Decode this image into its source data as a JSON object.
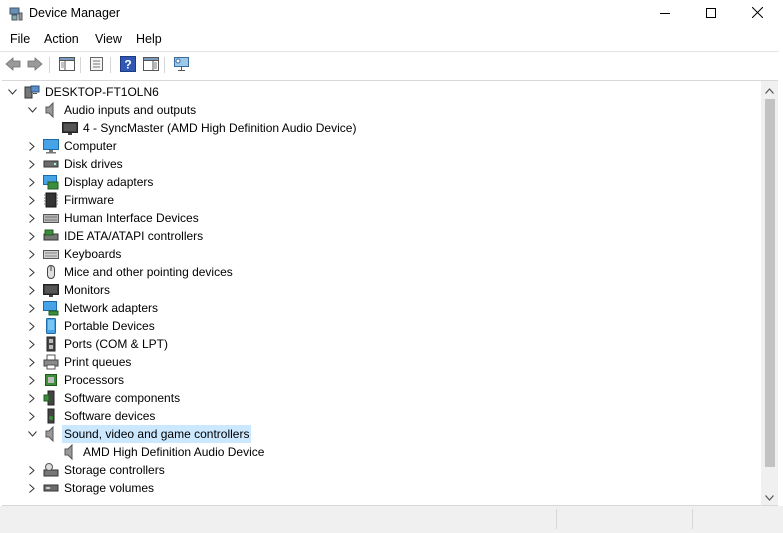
{
  "window": {
    "title": "Device Manager",
    "minimize_icon": "minimize-icon",
    "maximize_icon": "maximize-icon",
    "close_icon": "close-icon"
  },
  "menu": {
    "file": "File",
    "action": "Action",
    "view": "View",
    "help": "Help"
  },
  "toolbar": {
    "buttons": [
      "back-icon",
      "forward-icon",
      "show-hide-console-tree-icon",
      "properties-icon",
      "help-icon",
      "action-pane-icon",
      "scan-hardware-icon"
    ]
  },
  "tree": {
    "root": "DESKTOP-FT1OLN6",
    "items": [
      {
        "label": "Audio inputs and outputs",
        "icon": "speaker-icon",
        "expanded": true
      },
      {
        "label": "4 - SyncMaster (AMD High Definition Audio Device)",
        "icon": "monitor-icon",
        "child": true
      },
      {
        "label": "Computer",
        "icon": "computer-icon"
      },
      {
        "label": "Disk drives",
        "icon": "disk-drive-icon"
      },
      {
        "label": "Display adapters",
        "icon": "display-adapter-icon"
      },
      {
        "label": "Firmware",
        "icon": "firmware-icon"
      },
      {
        "label": "Human Interface Devices",
        "icon": "hid-icon"
      },
      {
        "label": "IDE ATA/ATAPI controllers",
        "icon": "ide-controller-icon"
      },
      {
        "label": "Keyboards",
        "icon": "keyboard-icon"
      },
      {
        "label": "Mice and other pointing devices",
        "icon": "mouse-icon"
      },
      {
        "label": "Monitors",
        "icon": "monitor-icon"
      },
      {
        "label": "Network adapters",
        "icon": "network-adapter-icon"
      },
      {
        "label": "Portable Devices",
        "icon": "portable-device-icon"
      },
      {
        "label": "Ports (COM & LPT)",
        "icon": "port-icon"
      },
      {
        "label": "Print queues",
        "icon": "printer-icon"
      },
      {
        "label": "Processors",
        "icon": "processor-icon"
      },
      {
        "label": "Software components",
        "icon": "software-component-icon"
      },
      {
        "label": "Software devices",
        "icon": "software-device-icon"
      },
      {
        "label": "Sound, video and game controllers",
        "icon": "speaker-icon",
        "expanded": true,
        "selected": true
      },
      {
        "label": "AMD High Definition Audio Device",
        "icon": "speaker-icon",
        "child": true
      },
      {
        "label": "Storage controllers",
        "icon": "storage-controller-icon"
      },
      {
        "label": "Storage volumes",
        "icon": "storage-volume-icon"
      }
    ]
  },
  "colors": {
    "selection": "#cce8ff",
    "scrollbar_thumb": "#c2c2c2"
  }
}
